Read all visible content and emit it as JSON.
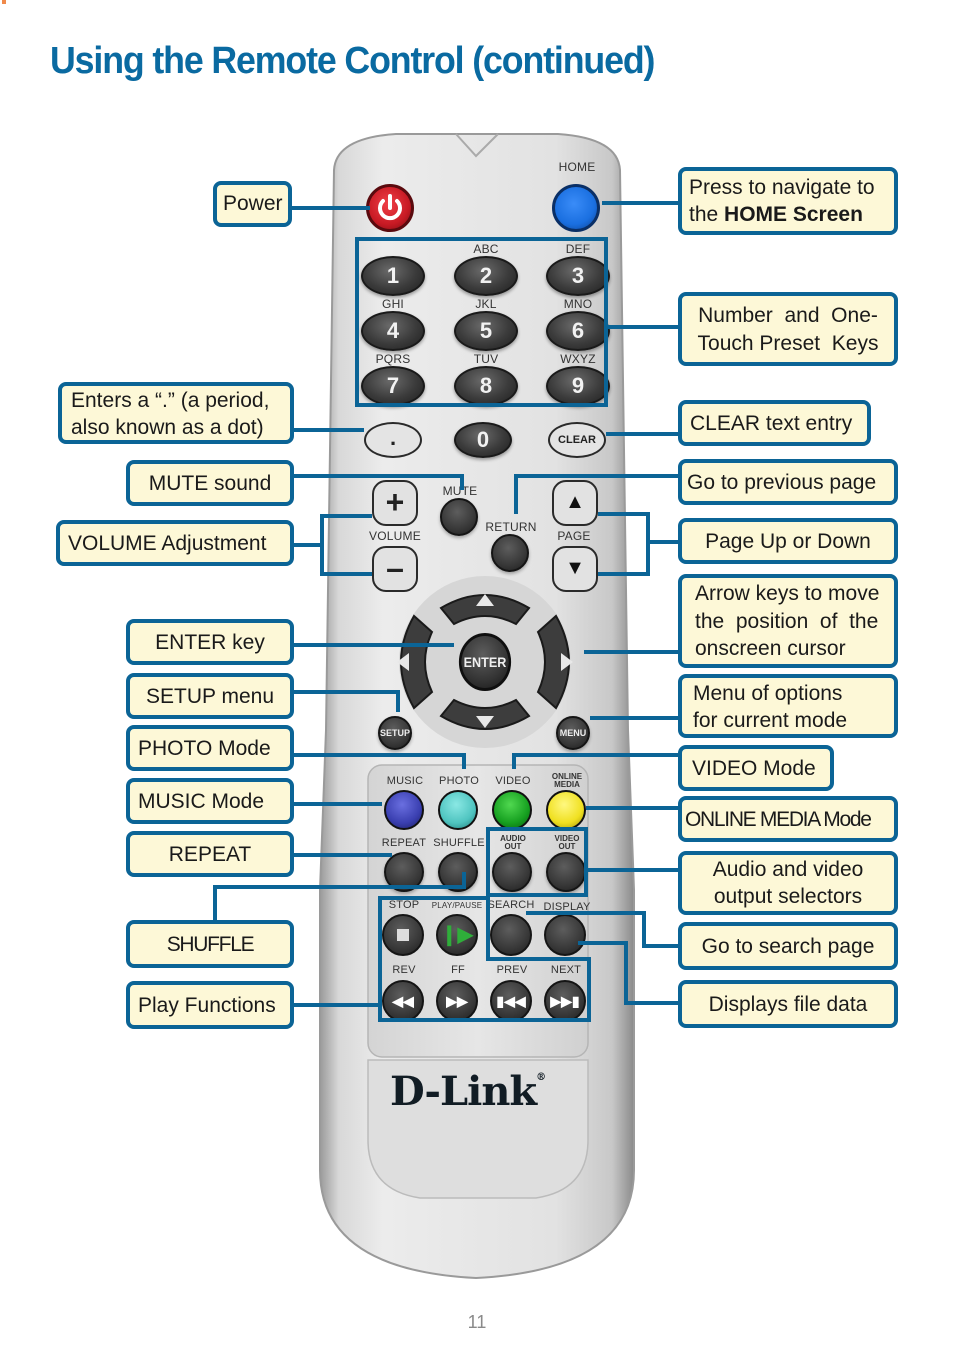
{
  "page": {
    "title": "Using the Remote Control (continued)",
    "page_number": "11"
  },
  "remote": {
    "brand": "D-Link",
    "brand_mark": "®",
    "home_label": "HOME",
    "number_keys": [
      {
        "digit": "1",
        "letters": ""
      },
      {
        "digit": "2",
        "letters": "ABC"
      },
      {
        "digit": "3",
        "letters": "DEF"
      },
      {
        "digit": "4",
        "letters": "GHI"
      },
      {
        "digit": "5",
        "letters": "JKL"
      },
      {
        "digit": "6",
        "letters": "MNO"
      },
      {
        "digit": "7",
        "letters": "PQRS"
      },
      {
        "digit": "8",
        "letters": "TUV"
      },
      {
        "digit": "9",
        "letters": "WXYZ"
      }
    ],
    "dot_key": ".",
    "zero_key": "0",
    "clear_key": "CLEAR",
    "mute_label": "MUTE",
    "volume_label": "VOLUME",
    "return_label": "RETURN",
    "page_label": "PAGE",
    "enter_key": "ENTER",
    "setup_key": "SETUP",
    "menu_key": "MENU",
    "mode_labels": {
      "music": "MUSIC",
      "photo": "PHOTO",
      "video": "VIDEO",
      "online_media_1": "ONLINE",
      "online_media_2": "MEDIA"
    },
    "mode_colors": {
      "music": "#3a3fb0",
      "photo": "#4fc4c0",
      "video": "#16a020",
      "online_media": "#f0e020"
    },
    "power_color": "#d0202a",
    "home_color": "#1a6fe0",
    "row2_labels": {
      "repeat": "REPEAT",
      "shuffle": "SHUFFLE",
      "audio_out_1": "AUDIO",
      "audio_out_2": "OUT",
      "video_out_1": "VIDEO",
      "video_out_2": "OUT"
    },
    "row3_labels": {
      "stop": "STOP",
      "play_pause": "PLAY/PAUSE",
      "search": "SEARCH",
      "display": "DISPLAY"
    },
    "row4_labels": {
      "rev": "REV",
      "ff": "FF",
      "prev": "PREV",
      "next": "NEXT"
    }
  },
  "callouts": {
    "power": "Power",
    "home_1": "Press to navigate to",
    "home_2_pre": "the ",
    "home_2_bold": "HOME Screen",
    "number_1": "Number  and  One-",
    "number_2": "Touch Preset  Keys",
    "dot_1": "Enters a “.” (a period,",
    "dot_2": "also known as a dot)",
    "clear": "CLEAR text entry",
    "mute": "MUTE sound",
    "return": "Go to previous page",
    "volume": "VOLUME Adjustment",
    "page": "Page Up or Down",
    "arrows_1": "Arrow keys to move",
    "arrows_2": "the  position  of  the",
    "arrows_3": "onscreen cursor",
    "enter": "ENTER key",
    "setup": "SETUP menu",
    "menu_1": "Menu of options",
    "menu_2": "for current mode",
    "photo": "PHOTO Mode",
    "video": "VIDEO Mode",
    "music": "MUSIC Mode",
    "online_media": "ONLINE MEDIA Mode",
    "repeat": "REPEAT",
    "av_out_1": "Audio and video",
    "av_out_2": "output selectors",
    "shuffle": "SHUFFLE",
    "search": "Go to search page",
    "play": "Play Functions",
    "display": "Displays file data"
  }
}
